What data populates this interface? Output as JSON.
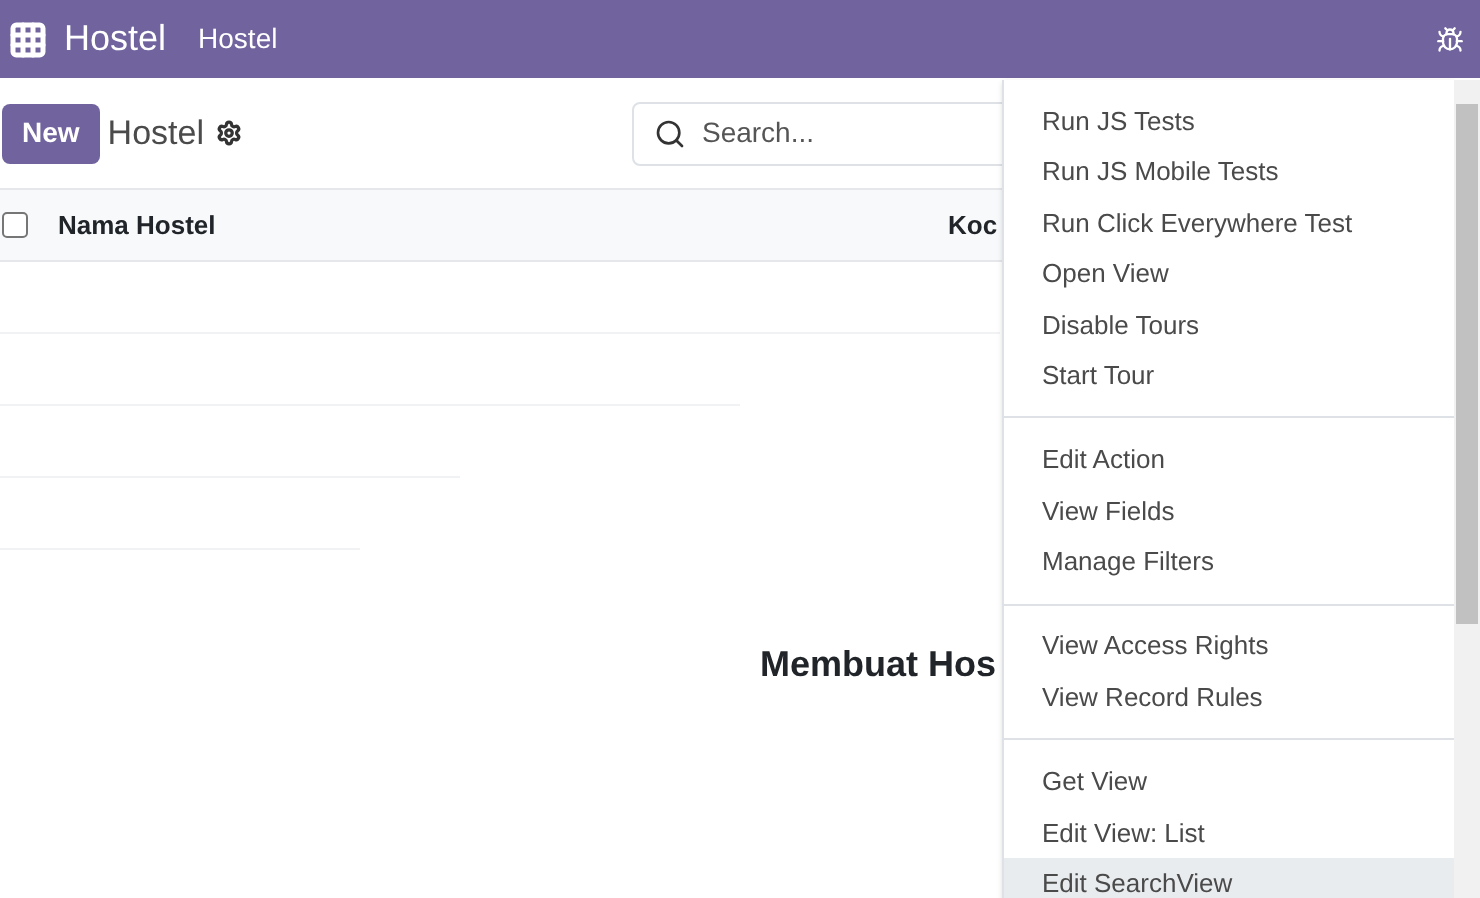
{
  "navbar": {
    "app_name": "Hostel",
    "menu": "Hostel"
  },
  "control_panel": {
    "new_button": "New",
    "breadcrumb": "Hostel",
    "search": {
      "placeholder": "Search..."
    }
  },
  "table": {
    "columns": [
      "Nama Hostel",
      "Koc"
    ],
    "select_all": {
      "checked": false
    }
  },
  "empty_state": {
    "title": "Membuat Hos"
  },
  "debug_menu": {
    "groups": [
      [
        {
          "label": "Run JS Tests",
          "selected": false
        },
        {
          "label": "Run JS Mobile Tests",
          "selected": false
        },
        {
          "label": "Run Click Everywhere Test",
          "selected": false
        },
        {
          "label": "Open View",
          "selected": false
        },
        {
          "label": "Disable Tours",
          "selected": false
        },
        {
          "label": "Start Tour",
          "selected": false
        }
      ],
      [
        {
          "label": "Edit Action",
          "selected": false
        },
        {
          "label": "View Fields",
          "selected": false
        },
        {
          "label": "Manage Filters",
          "selected": false
        }
      ],
      [
        {
          "label": "View Access Rights",
          "selected": false
        },
        {
          "label": "View Record Rules",
          "selected": false
        }
      ],
      [
        {
          "label": "Get View",
          "selected": false
        },
        {
          "label": "Edit View: List",
          "selected": false
        },
        {
          "label": "Edit SearchView",
          "selected": true
        }
      ]
    ]
  }
}
